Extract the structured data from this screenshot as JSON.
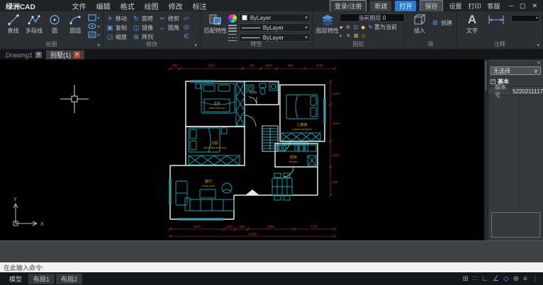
{
  "app": {
    "title": "绿洲CAD"
  },
  "menu": {
    "items": [
      "文件",
      "编辑",
      "格式",
      "绘图",
      "修改",
      "标注"
    ]
  },
  "titlebar": {
    "login": "登录/注册",
    "new": "新建",
    "open": "打开",
    "save": "保存",
    "settings": "设置",
    "print": "打印",
    "support": "客服"
  },
  "ribbon": {
    "draw": {
      "label": "绘图",
      "tools": [
        "直线",
        "多段线",
        "圆",
        "圆弧"
      ]
    },
    "modify": {
      "label": "修改",
      "tools": [
        "移动",
        "旋转",
        "修剪",
        "复制",
        "镜像",
        "圆角",
        "缩放",
        "阵列"
      ]
    },
    "properties": {
      "label": "特性",
      "match": "匹配特性",
      "color": "ByLayer",
      "lineweight": "ByLayer",
      "linetype": "ByLayer"
    },
    "layers": {
      "label": "图层",
      "props": "图层特性",
      "current": "当前图层 0",
      "set_current": "置为当前"
    },
    "block": {
      "label": "块",
      "insert": "插入",
      "create": "创建"
    },
    "annotate": {
      "label": "注释",
      "text": "文字"
    }
  },
  "tabs": [
    {
      "label": "Drawing1"
    },
    {
      "label": "别墅(1)"
    }
  ],
  "panel": {
    "selector": "无选择",
    "section": "基本",
    "rows": [
      {
        "key": "版本号",
        "value": "5220211117"
      }
    ]
  },
  "command": {
    "prompt": "在此输入命令:"
  },
  "statusbar": {
    "tabs": [
      "模型",
      "布局1",
      "布局2"
    ]
  },
  "plan": {
    "rooms": {
      "master": {
        "cn": "主卧",
        "en": "Main bedroom"
      },
      "second": {
        "cn": "次卧",
        "en": "secondary bedroom"
      },
      "children": {
        "cn": "儿童房",
        "en": "children bedroom"
      },
      "living": {
        "cn": "客厅",
        "en": "Living room"
      },
      "kitchen": {
        "cn": "厨房",
        "en": "Kitchen"
      },
      "bath": {
        "cn": "卫生间"
      }
    },
    "dims": {
      "top": [
        "900",
        "3310",
        "740",
        "1660",
        "860",
        "2100"
      ],
      "bottom": [
        "4670",
        "1012",
        "858",
        "3008",
        "1777"
      ],
      "total": "11500",
      "right": [
        "1440",
        "3240",
        "1120",
        "900"
      ]
    },
    "ucs": {
      "x": "X",
      "y": "Y"
    }
  },
  "colors": {
    "accent": "#2e7bd6",
    "wall": "#e8e8e8",
    "furniture": "#17a8b4",
    "label": "#d9a400",
    "dimension": "#d23a3a"
  }
}
